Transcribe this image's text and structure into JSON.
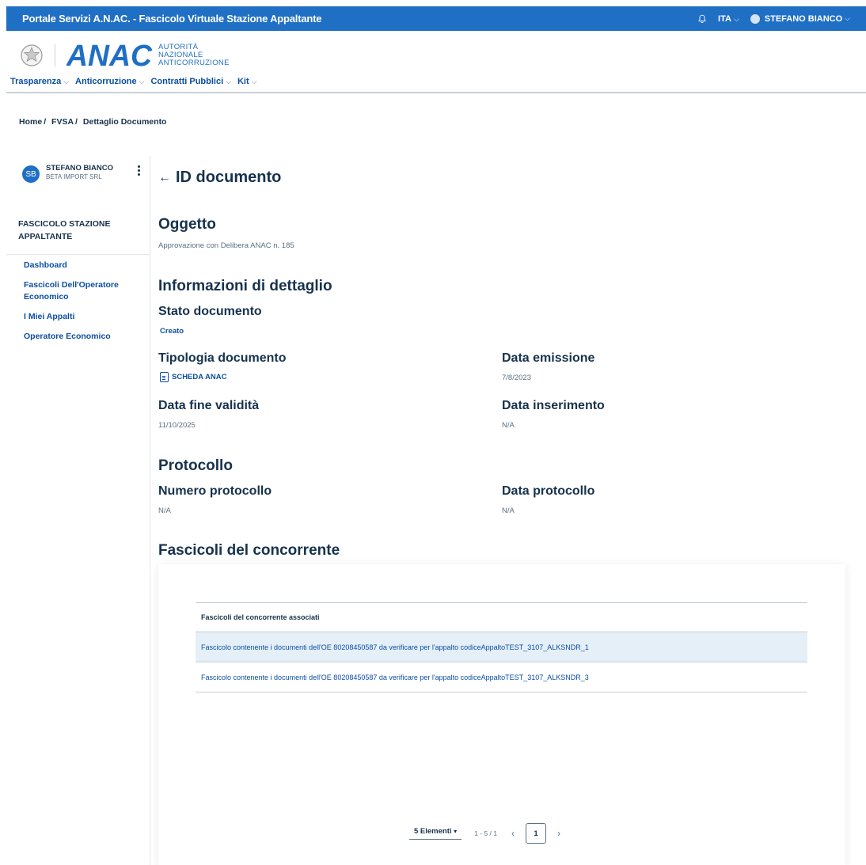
{
  "topbar": {
    "title": "Portale Servizi A.N.AC. - Fascicolo Virtuale Stazione Appaltante",
    "language": "ITA",
    "user": "STEFANO BIANCO"
  },
  "header": {
    "logo_text": "ANAC",
    "logo_sub1": "AUTORITÀ",
    "logo_sub2": "NAZIONALE",
    "logo_sub3": "ANTICORRUZIONE",
    "nav": [
      "Trasparenza",
      "Anticorruzione",
      "Contratti Pubblici",
      "Kit"
    ]
  },
  "breadcrumb": [
    "Home",
    "FVSA",
    "Dettaglio Documento"
  ],
  "sidebar": {
    "avatar_initials": "SB",
    "user_name": "STEFANO BIANCO",
    "user_org": "BETA IMPORT SRL",
    "section_title": "FASCICOLO STAZIONE APPALTANTE",
    "items": [
      "Dashboard",
      "Fascicoli Dell'Operatore Economico",
      "I Miei Appalti",
      "Operatore Economico"
    ]
  },
  "main": {
    "back_title": "ID documento",
    "oggetto_title": "Oggetto",
    "oggetto_value": "Approvazione con Delibera ANAC n. 185",
    "info_title": "Informazioni di dettaglio",
    "stato_label": "Stato documento",
    "stato_value": "Creato",
    "tipologia_label": "Tipologia documento",
    "tipologia_value": "SCHEDA ANAC",
    "data_emissione_label": "Data emissione",
    "data_emissione_value": "7/8/2023",
    "fine_validita_label": "Data fine validità",
    "fine_validita_value": "11/10/2025",
    "inserimento_label": "Data inserimento",
    "inserimento_value": "N/A",
    "protocollo_title": "Protocollo",
    "numero_protocollo_label": "Numero protocollo",
    "numero_protocollo_value": "N/A",
    "data_protocollo_label": "Data protocollo",
    "data_protocollo_value": "N/A",
    "fascicoli_title": "Fascicoli del concorrente"
  },
  "table": {
    "header": "Fascicoli del concorrente associati",
    "rows": [
      "Fascicolo contenente i documenti dell'OE 80208450587 da verificare per l'appalto codiceAppaltoTEST_3107_ALKSNDR_1",
      "Fascicolo contenente i documenti dell'OE 80208450587 da verificare per l'appalto codiceAppaltoTEST_3107_ALKSNDR_3"
    ]
  },
  "pagination": {
    "page_size": "5 Elementi",
    "range": "1 - 5 / 1",
    "current_page": "1"
  },
  "colors": {
    "primary": "#1f6fc5",
    "link": "#0b4ea2",
    "text": "#17324d",
    "highlight_row": "#e5eff7"
  }
}
